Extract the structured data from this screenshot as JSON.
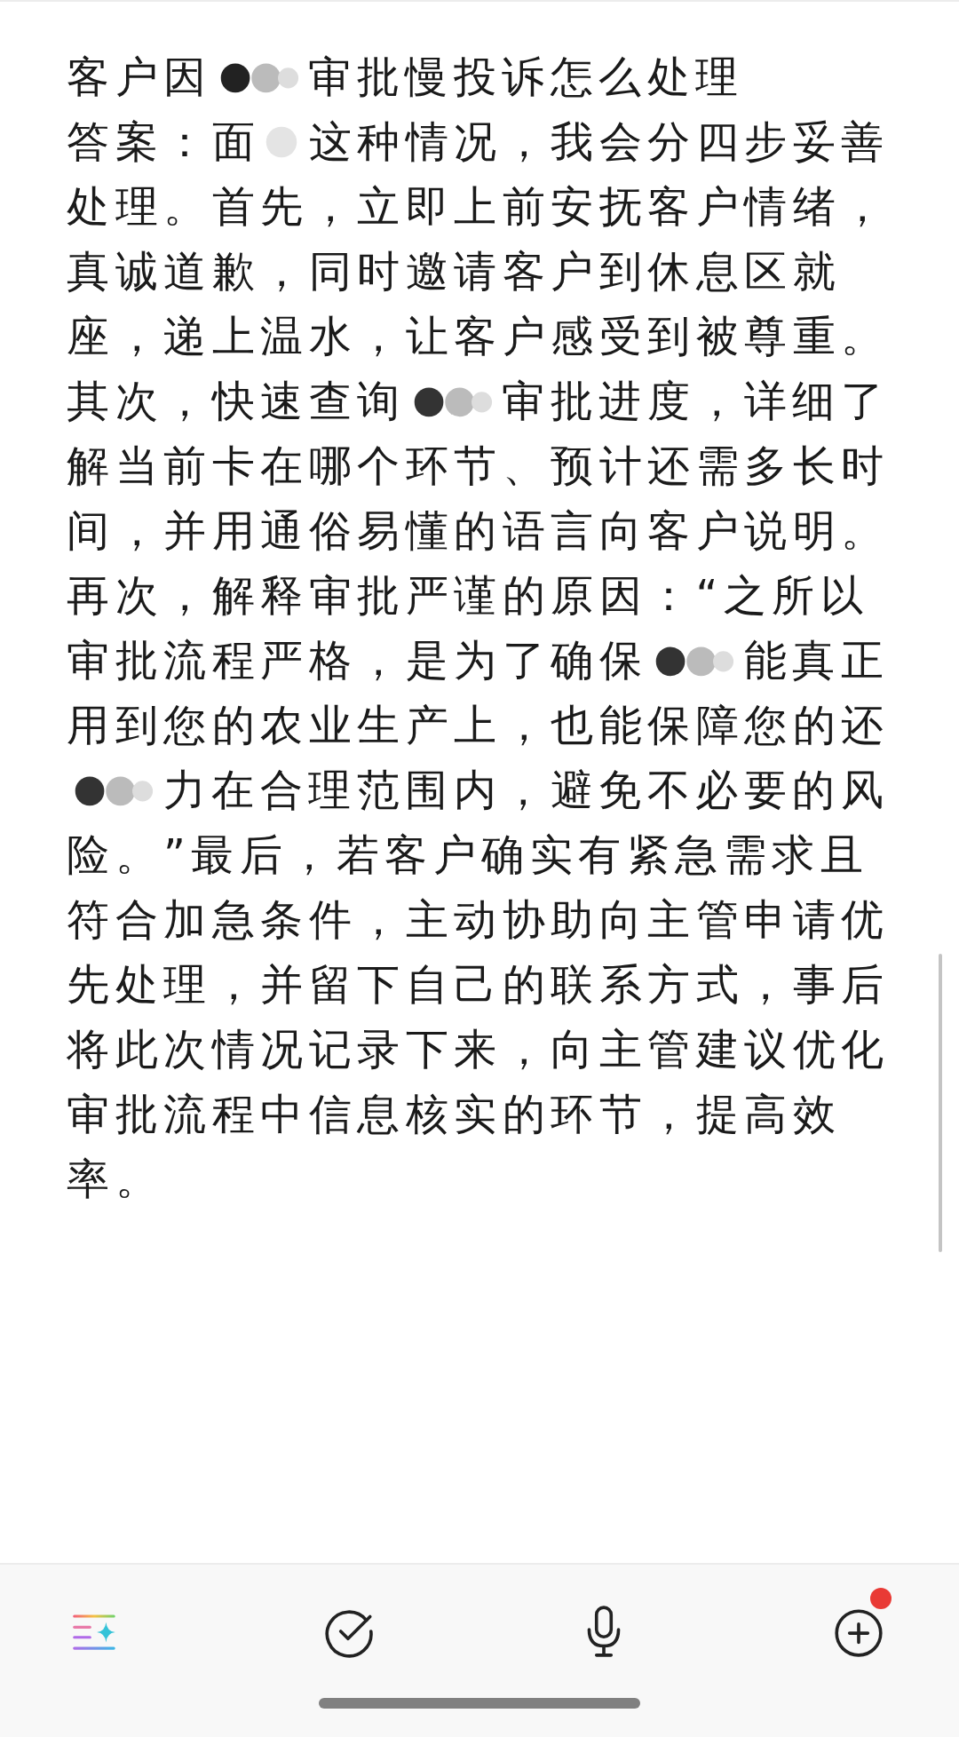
{
  "title": [
    {
      "kind": "text",
      "text": "客户因"
    },
    {
      "kind": "wideblot"
    },
    {
      "kind": "text",
      "text": "审批慢投诉怎么处理"
    }
  ],
  "answer_lines": [
    [
      {
        "kind": "text",
        "text": "答案：面"
      },
      {
        "kind": "blot"
      },
      {
        "kind": "text",
        "text": "这种情况，我会分四步妥善"
      }
    ],
    [
      {
        "kind": "text",
        "text": "处理。首先，立即上前安抚客户情绪，"
      }
    ],
    [
      {
        "kind": "text",
        "text": "真诚道歉，同时邀请客户到休息区就"
      }
    ],
    [
      {
        "kind": "text",
        "text": "座，递上温水，让客户感受到被尊重。"
      }
    ],
    [
      {
        "kind": "text",
        "text": "其次，快速查询"
      },
      {
        "kind": "wideblot"
      },
      {
        "kind": "text",
        "text": "审批进度，详细了"
      }
    ],
    [
      {
        "kind": "text",
        "text": "解当前卡在哪个环节、预计还需多长时"
      }
    ],
    [
      {
        "kind": "text",
        "text": "间，并用通俗易懂的语言向客户说明。"
      }
    ],
    [
      {
        "kind": "text",
        "text": "再次，解释审批严谨的原因：“之所以"
      }
    ],
    [
      {
        "kind": "text",
        "text": "审批流程严格，是为了确保"
      },
      {
        "kind": "wideblot"
      },
      {
        "kind": "text",
        "text": "能真正"
      }
    ],
    [
      {
        "kind": "text",
        "text": "用到您的农业生产上，也能保障您的还"
      }
    ],
    [
      {
        "kind": "wideblot"
      },
      {
        "kind": "text",
        "text": "力在合理范围内，避免不必要的风"
      }
    ],
    [
      {
        "kind": "text",
        "text": "险。”最后，若客户确实有紧急需求且"
      }
    ],
    [
      {
        "kind": "text",
        "text": "符合加急条件，主动协助向主管申请优"
      }
    ],
    [
      {
        "kind": "text",
        "text": "先处理，并留下自己的联系方式，事后"
      }
    ],
    [
      {
        "kind": "text",
        "text": "将此次情况记录下来，向主管建议优化"
      }
    ],
    [
      {
        "kind": "text",
        "text": "审批流程中信息核实的环节，提高效"
      }
    ],
    [
      {
        "kind": "text",
        "text": "率。"
      }
    ]
  ],
  "toolbar": [
    {
      "kind": "ai",
      "badge": false
    },
    {
      "kind": "check",
      "badge": false
    },
    {
      "kind": "mic",
      "badge": false
    },
    {
      "kind": "add",
      "badge": true
    }
  ]
}
